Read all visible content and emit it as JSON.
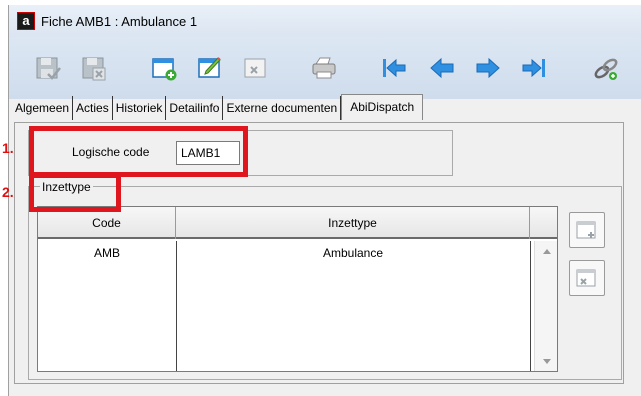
{
  "window": {
    "title": "Fiche AMB1 : Ambulance 1",
    "app_icon_letter": "a"
  },
  "toolbar": {
    "buttons": [
      {
        "name": "save-icon",
        "enabled": false
      },
      {
        "name": "save-close-icon",
        "enabled": false
      },
      {
        "name": "new-record-icon",
        "enabled": true
      },
      {
        "name": "edit-icon",
        "enabled": true
      },
      {
        "name": "delete-icon",
        "enabled": false
      },
      {
        "name": "print-icon",
        "enabled": true
      },
      {
        "name": "first-record-icon",
        "enabled": true
      },
      {
        "name": "previous-record-icon",
        "enabled": true
      },
      {
        "name": "next-record-icon",
        "enabled": true
      },
      {
        "name": "last-record-icon",
        "enabled": true
      },
      {
        "name": "link-icon",
        "enabled": true
      }
    ]
  },
  "tabs": [
    {
      "label": "Algemeen",
      "active": false
    },
    {
      "label": "Acties",
      "active": false
    },
    {
      "label": "Historiek",
      "active": false
    },
    {
      "label": "Detailinfo",
      "active": false
    },
    {
      "label": "Externe documenten",
      "active": false
    },
    {
      "label": "AbiDispatch",
      "active": true
    }
  ],
  "form": {
    "logische_code_label": "Logische code",
    "logische_code_value": "LAMB1",
    "inzettype_group_label": "Inzettype"
  },
  "grid": {
    "columns": [
      "Code",
      "Inzettype"
    ],
    "rows": [
      {
        "code": "AMB",
        "inzettype": "Ambulance"
      }
    ]
  },
  "side_buttons": [
    {
      "name": "add-row-icon"
    },
    {
      "name": "delete-row-icon"
    }
  ],
  "annotations": {
    "marker_1": "1.",
    "marker_2": "2."
  },
  "colors": {
    "highlight": "#e0161e",
    "toolbar_blue": "#2f8fe0",
    "add_green": "#3aaa35"
  }
}
